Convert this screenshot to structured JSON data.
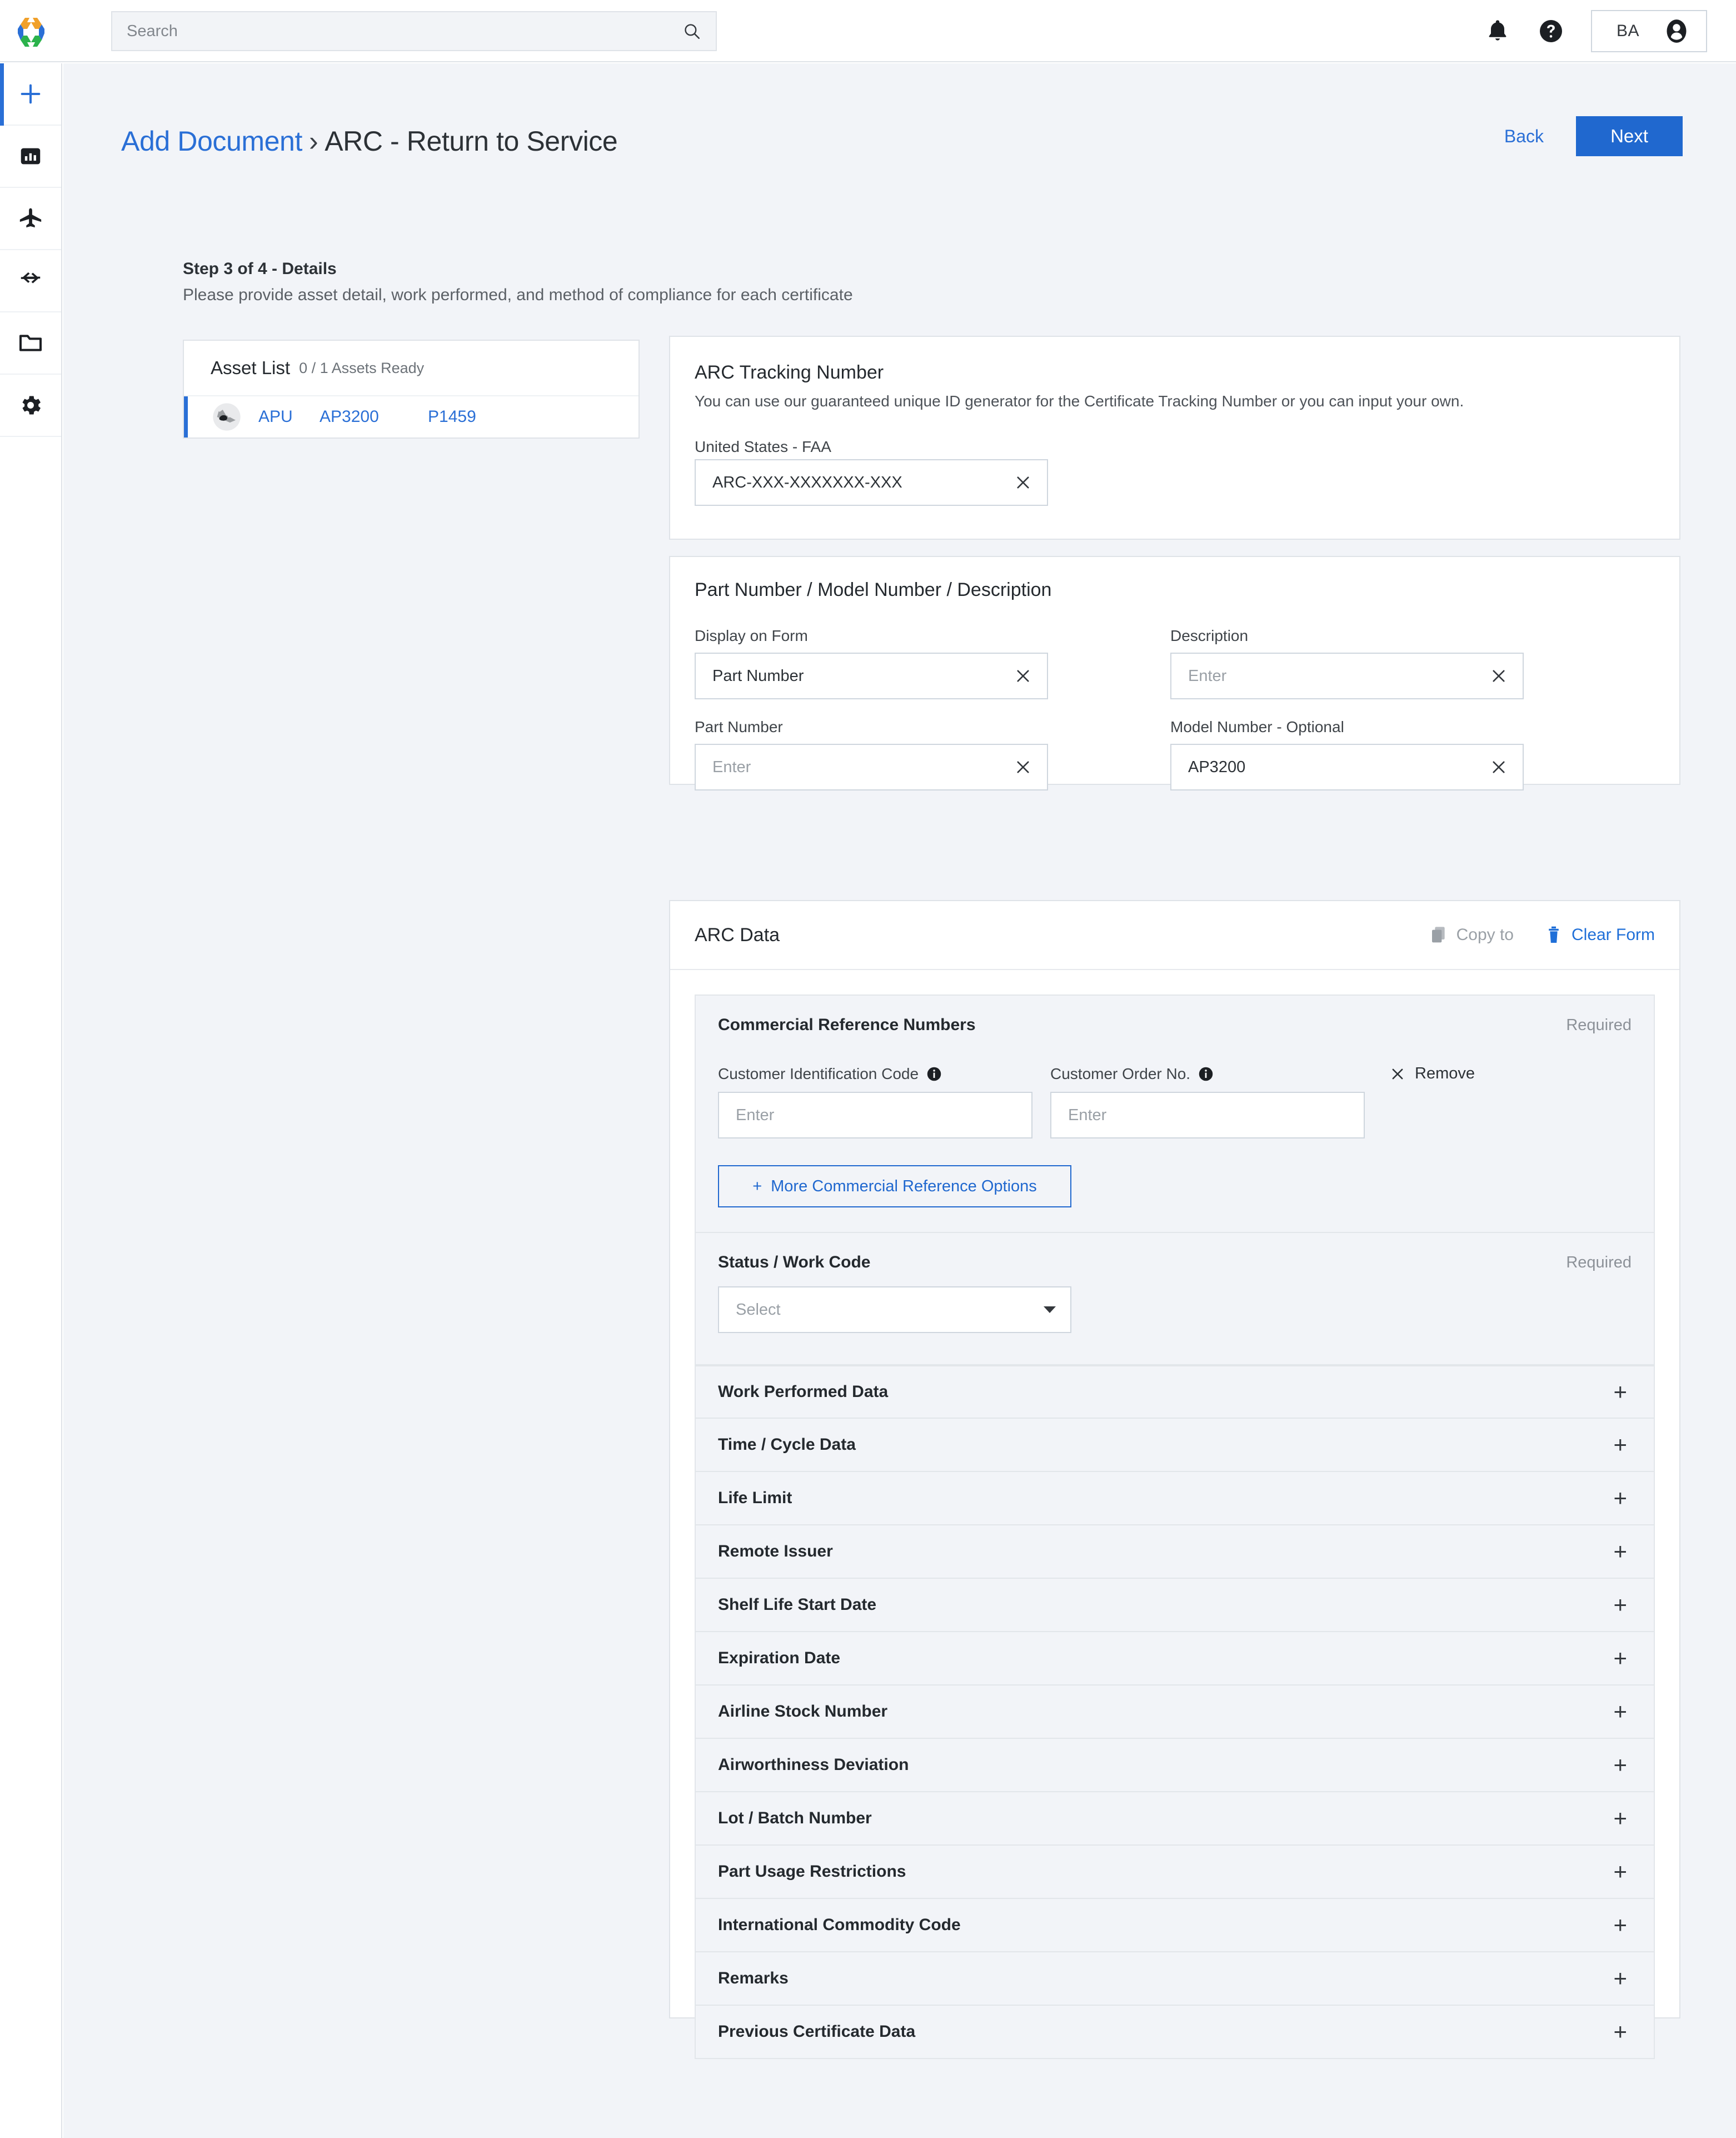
{
  "topbar": {
    "logo_name": "app-logo",
    "search": {
      "placeholder": "Search",
      "value": ""
    },
    "user_initials": "BA"
  },
  "sidebar": {
    "items": [
      {
        "name": "add",
        "icon": "plus-icon",
        "active": true
      },
      {
        "name": "dashboard",
        "icon": "chart-icon",
        "active": false
      },
      {
        "name": "aircraft",
        "icon": "airplane-icon",
        "active": false
      },
      {
        "name": "transfer",
        "icon": "transfer-arrows-icon",
        "active": false
      },
      {
        "name": "documents",
        "icon": "folder-icon",
        "active": false
      },
      {
        "name": "settings",
        "icon": "gear-icon",
        "active": false
      }
    ]
  },
  "header": {
    "breadcrumb_link": "Add Document",
    "breadcrumb_sep": "›",
    "breadcrumb_current": "ARC - Return to Service",
    "back_label": "Back",
    "next_label": "Next",
    "step_title": "Step 3 of 4 - Details",
    "step_subtitle": "Please provide asset detail, work performed, and method of compliance for each certificate"
  },
  "asset_list": {
    "title": "Asset List",
    "count": "0 / 1 Assets Ready",
    "rows": [
      {
        "icon": "apu-icon",
        "type": "APU",
        "model": "AP3200",
        "serial": "P1459"
      }
    ]
  },
  "tracking_card": {
    "title": "ARC Tracking Number",
    "description": "You can use our guaranteed unique ID generator for the Certificate Tracking Number or you can input your own.",
    "field_label": "United States - FAA",
    "field_value": "ARC-XXX-XXXXXXX-XXX",
    "field_placeholder": "Enter"
  },
  "part_card": {
    "title": "Part Number / Model Number / Description",
    "fields": [
      {
        "label": "Display on Form",
        "value": "Part Number",
        "placeholder": "Enter"
      },
      {
        "label": "Description",
        "value": "",
        "placeholder": "Enter"
      },
      {
        "label": "Part Number",
        "value": "",
        "placeholder": "Enter"
      },
      {
        "label": "Model Number - Optional",
        "value": "AP3200",
        "placeholder": "Enter"
      }
    ]
  },
  "arc_data": {
    "title": "ARC Data",
    "copy_to_label": "Copy to",
    "clear_form_label": "Clear Form",
    "commercial": {
      "title": "Commercial Reference Numbers",
      "required_label": "Required",
      "remove_label": "Remove",
      "fields": [
        {
          "label": "Customer Identification Code",
          "value": "",
          "placeholder": "Enter"
        },
        {
          "label": "Customer Order No.",
          "value": "",
          "placeholder": "Enter"
        }
      ],
      "more_button": "More Commercial Reference Options",
      "more_button_prefix": "+"
    },
    "status_work_code": {
      "title": "Status / Work Code",
      "required_label": "Required",
      "select_placeholder": "Select",
      "select_value": ""
    },
    "accordions": [
      {
        "label": "Work Performed Data",
        "toggle": "+"
      },
      {
        "label": "Time / Cycle Data",
        "toggle": "+"
      },
      {
        "label": "Life Limit",
        "toggle": "+"
      },
      {
        "label": "Remote Issuer",
        "toggle": "+"
      },
      {
        "label": "Shelf Life Start Date",
        "toggle": "+"
      },
      {
        "label": "Expiration Date",
        "toggle": "+"
      },
      {
        "label": "Airline Stock Number",
        "toggle": "+"
      },
      {
        "label": "Airworthiness Deviation",
        "toggle": "+"
      },
      {
        "label": "Lot / Batch Number",
        "toggle": "+"
      },
      {
        "label": "Part Usage Restrictions",
        "toggle": "+"
      },
      {
        "label": "International Commodity Code",
        "toggle": "+"
      },
      {
        "label": "Remarks",
        "toggle": "+"
      },
      {
        "label": "Previous Certificate Data",
        "toggle": "+"
      }
    ]
  },
  "colors": {
    "accent_blue": "#2068cf",
    "link_blue": "#2a6fd6",
    "page_bg": "#f2f4f8",
    "card_bg": "#ffffff",
    "border": "#dfe3e8",
    "text": "#24292e",
    "muted": "#8c9198"
  }
}
